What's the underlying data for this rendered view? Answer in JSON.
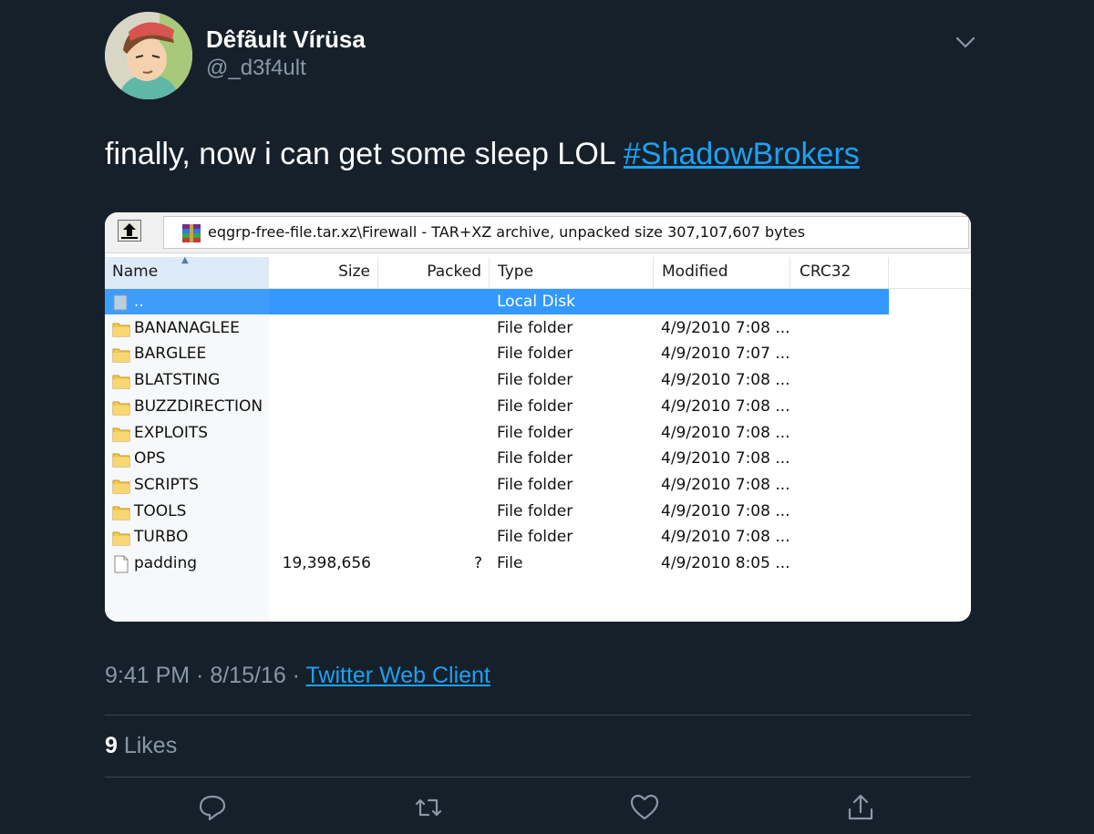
{
  "tweet": {
    "display_name": "Dêfãult Vírüsa",
    "handle": "@_d3f4ult",
    "text_prefix": "finally, now i can get some sleep LOL ",
    "hashtag": "#ShadowBrokers",
    "time": "9:41 PM · 8/15/16 · ",
    "source": "Twitter Web Client",
    "likes_count": "9",
    "likes_label": " Likes"
  },
  "screenshot": {
    "address": "eqgrp-free-file.tar.xz\\Firewall - TAR+XZ archive, unpacked size 307,107,607 bytes",
    "columns": [
      "Name",
      "Size",
      "Packed",
      "Type",
      "Modified",
      "CRC32"
    ],
    "rows": [
      {
        "name": "..",
        "size": "",
        "packed": "",
        "type": "Local Disk",
        "modified": "",
        "icon": "up-folder-icon",
        "selected": true
      },
      {
        "name": "BANANAGLEE",
        "size": "",
        "packed": "",
        "type": "File folder",
        "modified": "4/9/2010 7:08 ...",
        "icon": "folder-icon"
      },
      {
        "name": "BARGLEE",
        "size": "",
        "packed": "",
        "type": "File folder",
        "modified": "4/9/2010 7:07 ...",
        "icon": "folder-icon"
      },
      {
        "name": "BLATSTING",
        "size": "",
        "packed": "",
        "type": "File folder",
        "modified": "4/9/2010 7:08 ...",
        "icon": "folder-icon"
      },
      {
        "name": "BUZZDIRECTION",
        "size": "",
        "packed": "",
        "type": "File folder",
        "modified": "4/9/2010 7:08 ...",
        "icon": "folder-icon"
      },
      {
        "name": "EXPLOITS",
        "size": "",
        "packed": "",
        "type": "File folder",
        "modified": "4/9/2010 7:08 ...",
        "icon": "folder-icon"
      },
      {
        "name": "OPS",
        "size": "",
        "packed": "",
        "type": "File folder",
        "modified": "4/9/2010 7:08 ...",
        "icon": "folder-icon"
      },
      {
        "name": "SCRIPTS",
        "size": "",
        "packed": "",
        "type": "File folder",
        "modified": "4/9/2010 7:08 ...",
        "icon": "folder-icon"
      },
      {
        "name": "TOOLS",
        "size": "",
        "packed": "",
        "type": "File folder",
        "modified": "4/9/2010 7:08 ...",
        "icon": "folder-icon"
      },
      {
        "name": "TURBO",
        "size": "",
        "packed": "",
        "type": "File folder",
        "modified": "4/9/2010 7:08 ...",
        "icon": "folder-icon"
      },
      {
        "name": "padding",
        "size": "19,398,656",
        "packed": "?",
        "type": "File",
        "modified": "4/9/2010 8:05 ...",
        "icon": "file-icon"
      }
    ]
  },
  "actions": [
    "reply-icon",
    "retweet-icon",
    "like-icon",
    "share-icon"
  ],
  "colors": {
    "background": "#15202b",
    "link": "#1da1f2",
    "secondary_text": "#8899a6",
    "selection": "#3399ff"
  }
}
